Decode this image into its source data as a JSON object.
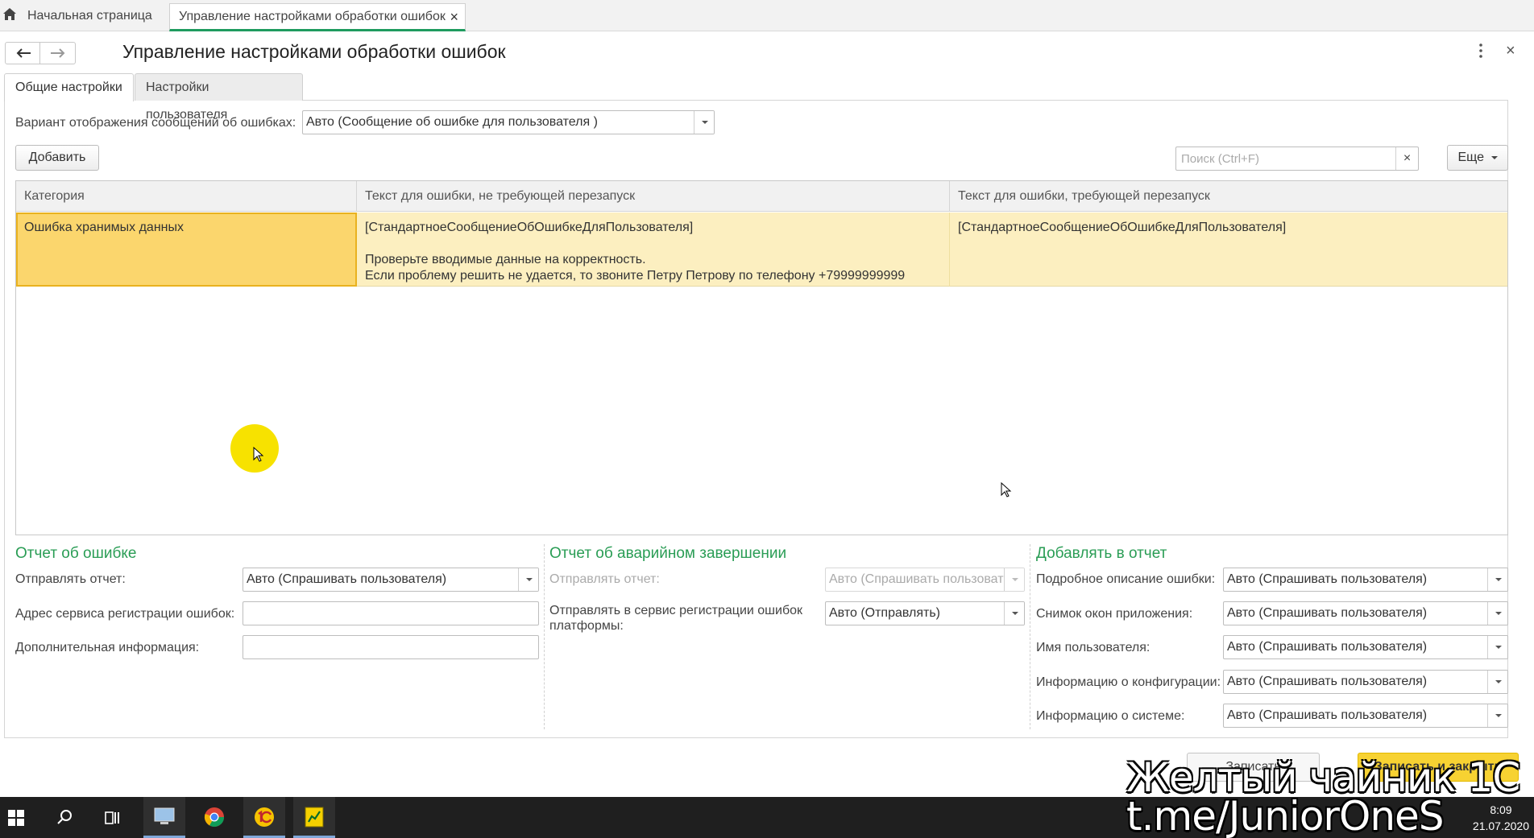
{
  "tabs": {
    "home": "Начальная страница",
    "current": "Управление настройками обработки ошибок",
    "close": "×"
  },
  "page": {
    "title": "Управление настройками обработки ошибок",
    "close": "×"
  },
  "form_tabs": {
    "general": "Общие настройки",
    "user": "Настройки пользователя"
  },
  "display_variant": {
    "label": "Вариант отображения сообщений об ошибках:",
    "value": "Авто (Сообщение об ошибке для пользователя )"
  },
  "toolbar": {
    "add": "Добавить",
    "search_placeholder": "Поиск (Ctrl+F)",
    "search_clear": "×",
    "more": "Еще"
  },
  "table": {
    "columns": [
      "Категория",
      "Текст для ошибки, не требующей перезапуск",
      "Текст для ошибки, требующей перезапуск"
    ],
    "rows": [
      {
        "category": "Ошибка хранимых данных",
        "no_restart": {
          "line1": "[СтандартноеСообщениеОбОшибкеДляПользователя]",
          "line2": "Проверьте вводимые данные на корректность.",
          "line3": "Если проблему решить не удается, то звоните Петру Петрову по телефону +79999999999"
        },
        "restart": "[СтандартноеСообщениеОбОшибкеДляПользователя]"
      }
    ]
  },
  "error_report": {
    "title": "Отчет об ошибке",
    "send_label": "Отправлять отчет:",
    "send_value": "Авто (Спрашивать пользователя)",
    "service_label": "Адрес сервиса регистрации ошибок:",
    "service_value": "",
    "extra_label": "Дополнительная информация:",
    "extra_value": ""
  },
  "crash_report": {
    "title": "Отчет об аварийном завершении",
    "send_label": "Отправлять отчет:",
    "send_value": "Авто (Спрашивать пользоват",
    "platform_label_1": "Отправлять в сервис регистрации ошибок",
    "platform_label_2": "платформы:",
    "platform_value": "Авто (Отправлять)"
  },
  "add_to_report": {
    "title": "Добавлять в отчет",
    "items": [
      {
        "label": "Подробное описание ошибки:",
        "value": "Авто (Спрашивать пользователя)"
      },
      {
        "label": "Снимок окон приложения:",
        "value": "Авто (Спрашивать пользователя)"
      },
      {
        "label": "Имя пользователя:",
        "value": "Авто (Спрашивать пользователя)"
      },
      {
        "label": "Информацию о конфигурации:",
        "value": "Авто (Спрашивать пользователя)"
      },
      {
        "label": "Информацию о системе:",
        "value": "Авто (Спрашивать пользователя)"
      }
    ]
  },
  "bottom": {
    "write": "Записать",
    "save_close": "Записать и закрыть"
  },
  "taskbar": {
    "time": "8:09",
    "date": "21.07.2020"
  },
  "watermark": {
    "line1": "Желтый чайник 1С",
    "line2": "t.me/JuniorOneS"
  },
  "colors": {
    "accent_green": "#2a9d55",
    "row_highlight": "#fcefc0",
    "selected_cell": "#fbd66d",
    "primary_button": "#f7d232"
  }
}
